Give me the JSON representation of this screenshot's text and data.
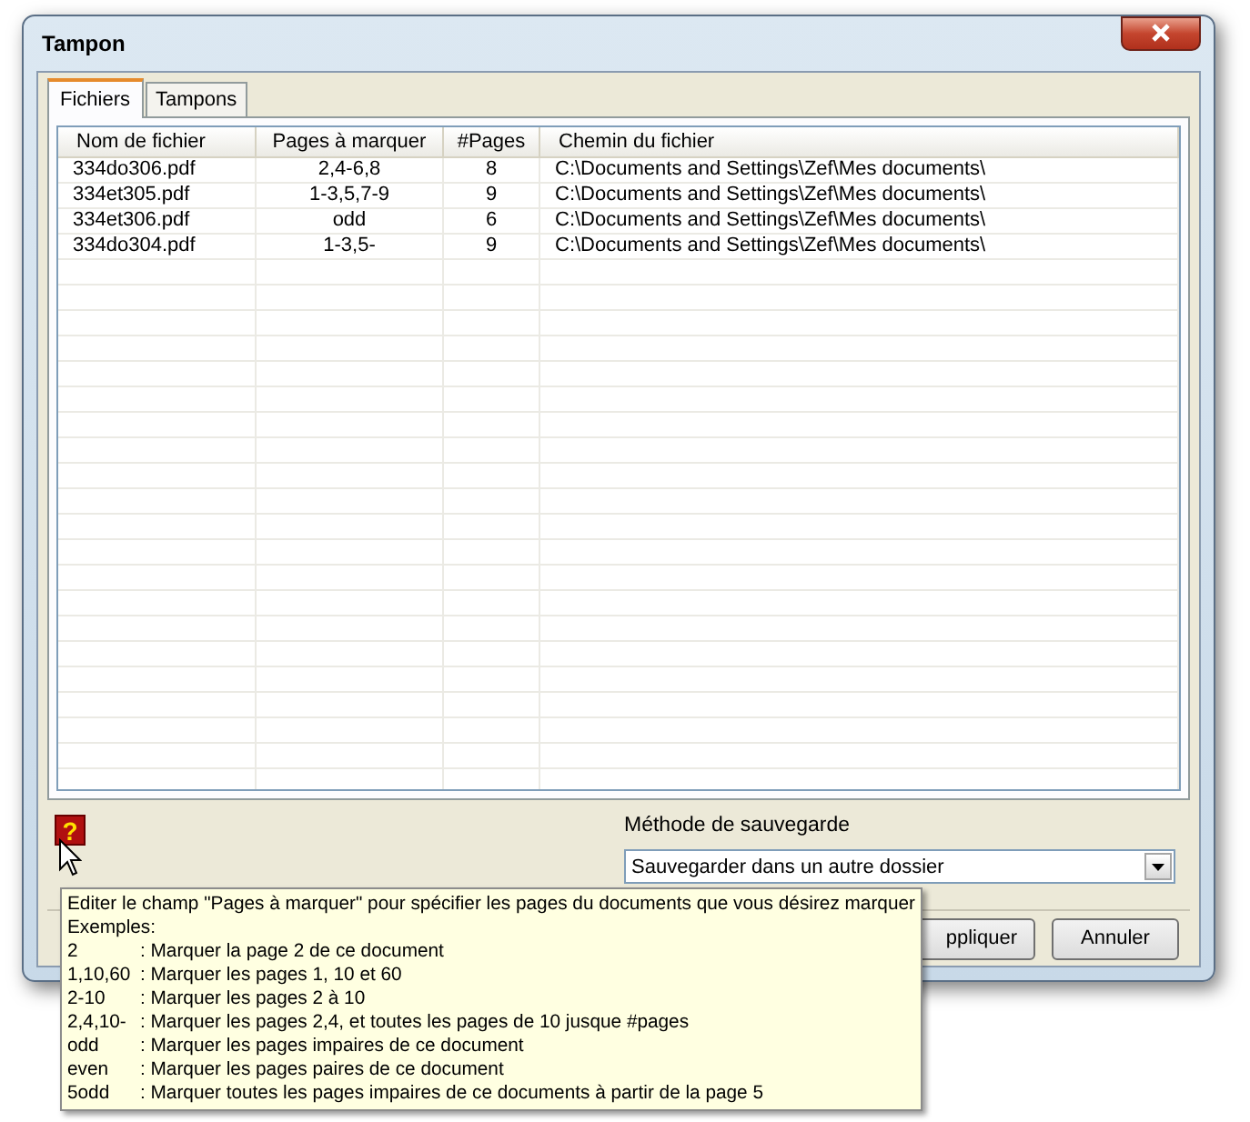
{
  "window": {
    "title": "Tampon"
  },
  "tabs": [
    {
      "label": "Fichiers",
      "selected": true
    },
    {
      "label": "Tampons",
      "selected": false
    }
  ],
  "table": {
    "columns": [
      "Nom de fichier",
      "Pages à marquer",
      "#Pages",
      "Chemin du fichier"
    ],
    "rows": [
      [
        "334do306.pdf",
        "2,4-6,8",
        "8",
        "C:\\Documents and Settings\\Zef\\Mes documents\\"
      ],
      [
        "334et305.pdf",
        "1-3,5,7-9",
        "9",
        "C:\\Documents and Settings\\Zef\\Mes documents\\"
      ],
      [
        "334et306.pdf",
        "odd",
        "6",
        "C:\\Documents and Settings\\Zef\\Mes documents\\"
      ],
      [
        "334do304.pdf",
        "1-3,5-",
        "9",
        "C:\\Documents and Settings\\Zef\\Mes documents\\"
      ]
    ]
  },
  "save_method": {
    "label": "Méthode de sauvegarde",
    "value": "Sauvegarder dans un autre dossier"
  },
  "help_icon": "?",
  "buttons": [
    "ppliquer",
    "Annuler"
  ],
  "tooltip": {
    "text": "Editer le champ \"Pages à marquer\" pour spécifier les pages du documents que vous désirez marquer",
    "heading": "Exemples:",
    "examples": [
      {
        "code": "2",
        "description": ": Marquer la page 2 de ce document"
      },
      {
        "code": "1,10,60",
        "description": ": Marquer les pages 1, 10 et 60"
      },
      {
        "code": "2-10",
        "description": ": Marquer les pages 2 à 10"
      },
      {
        "code": "2,4,10-",
        "description": ": Marquer les pages 2,4, et toutes les pages de 10 jusque #pages"
      },
      {
        "code": "odd",
        "description": ": Marquer les pages impaires de ce document"
      },
      {
        "code": "even",
        "description": ": Marquer les pages paires de ce document"
      },
      {
        "code": "5odd",
        "description": ": Marquer toutes les pages impaires de ce documents à partir de la page 5"
      }
    ]
  }
}
